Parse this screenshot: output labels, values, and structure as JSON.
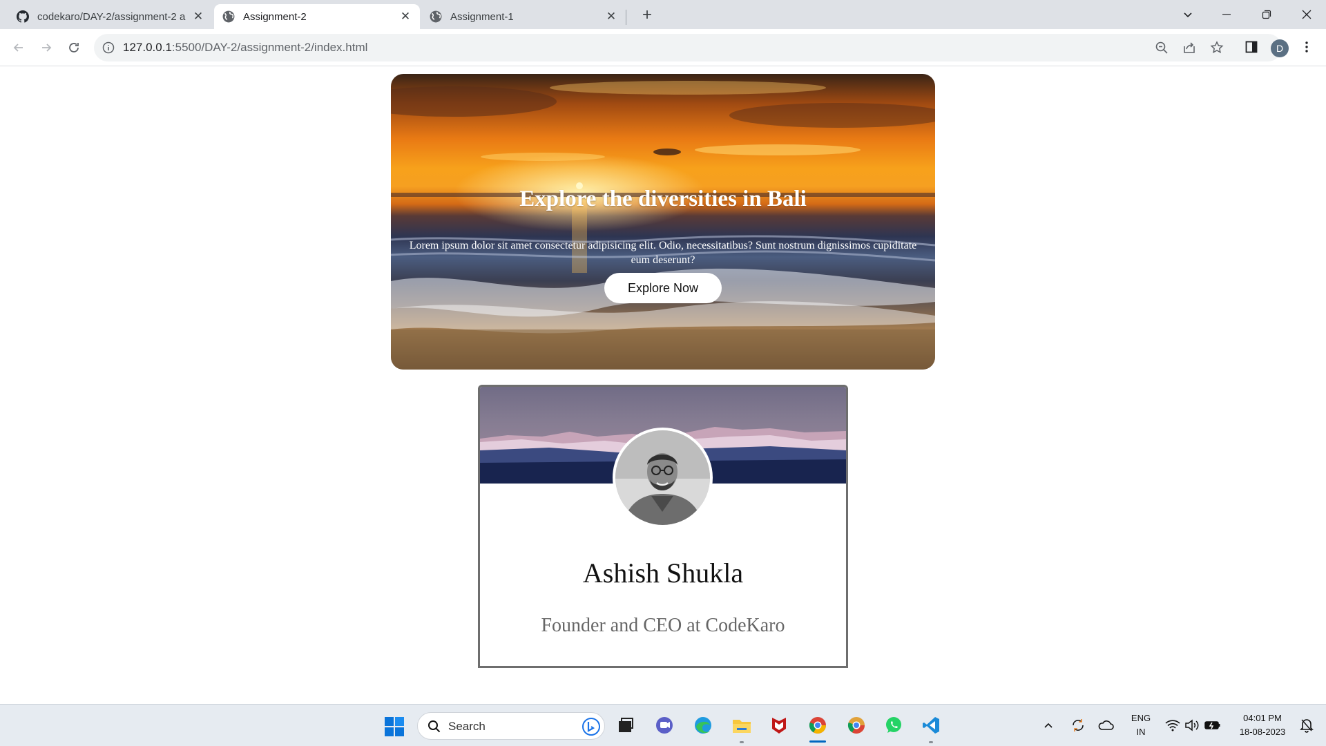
{
  "browser": {
    "tabs": [
      {
        "title": "codekaro/DAY-2/assignment-2 a",
        "icon": "github-icon",
        "active": false
      },
      {
        "title": "Assignment-2",
        "icon": "globe-icon",
        "active": true
      },
      {
        "title": "Assignment-1",
        "icon": "globe-icon",
        "active": false
      }
    ],
    "address": {
      "host": "127.0.0.1",
      "path": ":5500/DAY-2/assignment-2/index.html"
    },
    "profile_initial": "D"
  },
  "hero": {
    "title": "Explore the diversities in Bali",
    "text": "Lorem ipsum dolor sit amet consectetur adipisicing elit. Odio, necessitatibus? Sunt nostrum dignissimos cupiditate eum deserunt?",
    "button": "Explore Now"
  },
  "profile_card": {
    "name": "Ashish Shukla",
    "role": "Founder and CEO at CodeKaro"
  },
  "taskbar": {
    "search_label": "Search",
    "language": "ENG",
    "region": "IN",
    "time": "04:01 PM",
    "date": "18-08-2023",
    "apps": [
      "windows-start-icon",
      "bing-icon",
      "task-view-icon",
      "teams-chat-icon",
      "edge-icon",
      "file-explorer-icon",
      "mcafee-icon",
      "chrome-icon",
      "chrome-canary-icon",
      "whatsapp-icon",
      "vscode-icon"
    ]
  },
  "colors": {
    "accent": "#0067c0",
    "tab_strip": "#dee1e6"
  }
}
